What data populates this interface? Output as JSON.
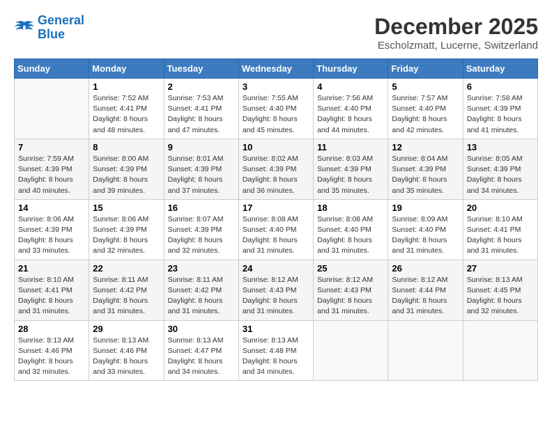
{
  "logo": {
    "line1": "General",
    "line2": "Blue"
  },
  "title": "December 2025",
  "location": "Escholzmatt, Lucerne, Switzerland",
  "days_of_week": [
    "Sunday",
    "Monday",
    "Tuesday",
    "Wednesday",
    "Thursday",
    "Friday",
    "Saturday"
  ],
  "weeks": [
    [
      {
        "day": "",
        "info": ""
      },
      {
        "day": "1",
        "info": "Sunrise: 7:52 AM\nSunset: 4:41 PM\nDaylight: 8 hours\nand 48 minutes."
      },
      {
        "day": "2",
        "info": "Sunrise: 7:53 AM\nSunset: 4:41 PM\nDaylight: 8 hours\nand 47 minutes."
      },
      {
        "day": "3",
        "info": "Sunrise: 7:55 AM\nSunset: 4:40 PM\nDaylight: 8 hours\nand 45 minutes."
      },
      {
        "day": "4",
        "info": "Sunrise: 7:56 AM\nSunset: 4:40 PM\nDaylight: 8 hours\nand 44 minutes."
      },
      {
        "day": "5",
        "info": "Sunrise: 7:57 AM\nSunset: 4:40 PM\nDaylight: 8 hours\nand 42 minutes."
      },
      {
        "day": "6",
        "info": "Sunrise: 7:58 AM\nSunset: 4:39 PM\nDaylight: 8 hours\nand 41 minutes."
      }
    ],
    [
      {
        "day": "7",
        "info": "Sunrise: 7:59 AM\nSunset: 4:39 PM\nDaylight: 8 hours\nand 40 minutes."
      },
      {
        "day": "8",
        "info": "Sunrise: 8:00 AM\nSunset: 4:39 PM\nDaylight: 8 hours\nand 39 minutes."
      },
      {
        "day": "9",
        "info": "Sunrise: 8:01 AM\nSunset: 4:39 PM\nDaylight: 8 hours\nand 37 minutes."
      },
      {
        "day": "10",
        "info": "Sunrise: 8:02 AM\nSunset: 4:39 PM\nDaylight: 8 hours\nand 36 minutes."
      },
      {
        "day": "11",
        "info": "Sunrise: 8:03 AM\nSunset: 4:39 PM\nDaylight: 8 hours\nand 35 minutes."
      },
      {
        "day": "12",
        "info": "Sunrise: 8:04 AM\nSunset: 4:39 PM\nDaylight: 8 hours\nand 35 minutes."
      },
      {
        "day": "13",
        "info": "Sunrise: 8:05 AM\nSunset: 4:39 PM\nDaylight: 8 hours\nand 34 minutes."
      }
    ],
    [
      {
        "day": "14",
        "info": "Sunrise: 8:06 AM\nSunset: 4:39 PM\nDaylight: 8 hours\nand 33 minutes."
      },
      {
        "day": "15",
        "info": "Sunrise: 8:06 AM\nSunset: 4:39 PM\nDaylight: 8 hours\nand 32 minutes."
      },
      {
        "day": "16",
        "info": "Sunrise: 8:07 AM\nSunset: 4:39 PM\nDaylight: 8 hours\nand 32 minutes."
      },
      {
        "day": "17",
        "info": "Sunrise: 8:08 AM\nSunset: 4:40 PM\nDaylight: 8 hours\nand 31 minutes."
      },
      {
        "day": "18",
        "info": "Sunrise: 8:08 AM\nSunset: 4:40 PM\nDaylight: 8 hours\nand 31 minutes."
      },
      {
        "day": "19",
        "info": "Sunrise: 8:09 AM\nSunset: 4:40 PM\nDaylight: 8 hours\nand 31 minutes."
      },
      {
        "day": "20",
        "info": "Sunrise: 8:10 AM\nSunset: 4:41 PM\nDaylight: 8 hours\nand 31 minutes."
      }
    ],
    [
      {
        "day": "21",
        "info": "Sunrise: 8:10 AM\nSunset: 4:41 PM\nDaylight: 8 hours\nand 31 minutes."
      },
      {
        "day": "22",
        "info": "Sunrise: 8:11 AM\nSunset: 4:42 PM\nDaylight: 8 hours\nand 31 minutes."
      },
      {
        "day": "23",
        "info": "Sunrise: 8:11 AM\nSunset: 4:42 PM\nDaylight: 8 hours\nand 31 minutes."
      },
      {
        "day": "24",
        "info": "Sunrise: 8:12 AM\nSunset: 4:43 PM\nDaylight: 8 hours\nand 31 minutes."
      },
      {
        "day": "25",
        "info": "Sunrise: 8:12 AM\nSunset: 4:43 PM\nDaylight: 8 hours\nand 31 minutes."
      },
      {
        "day": "26",
        "info": "Sunrise: 8:12 AM\nSunset: 4:44 PM\nDaylight: 8 hours\nand 31 minutes."
      },
      {
        "day": "27",
        "info": "Sunrise: 8:13 AM\nSunset: 4:45 PM\nDaylight: 8 hours\nand 32 minutes."
      }
    ],
    [
      {
        "day": "28",
        "info": "Sunrise: 8:13 AM\nSunset: 4:46 PM\nDaylight: 8 hours\nand 32 minutes."
      },
      {
        "day": "29",
        "info": "Sunrise: 8:13 AM\nSunset: 4:46 PM\nDaylight: 8 hours\nand 33 minutes."
      },
      {
        "day": "30",
        "info": "Sunrise: 8:13 AM\nSunset: 4:47 PM\nDaylight: 8 hours\nand 34 minutes."
      },
      {
        "day": "31",
        "info": "Sunrise: 8:13 AM\nSunset: 4:48 PM\nDaylight: 8 hours\nand 34 minutes."
      },
      {
        "day": "",
        "info": ""
      },
      {
        "day": "",
        "info": ""
      },
      {
        "day": "",
        "info": ""
      }
    ]
  ]
}
